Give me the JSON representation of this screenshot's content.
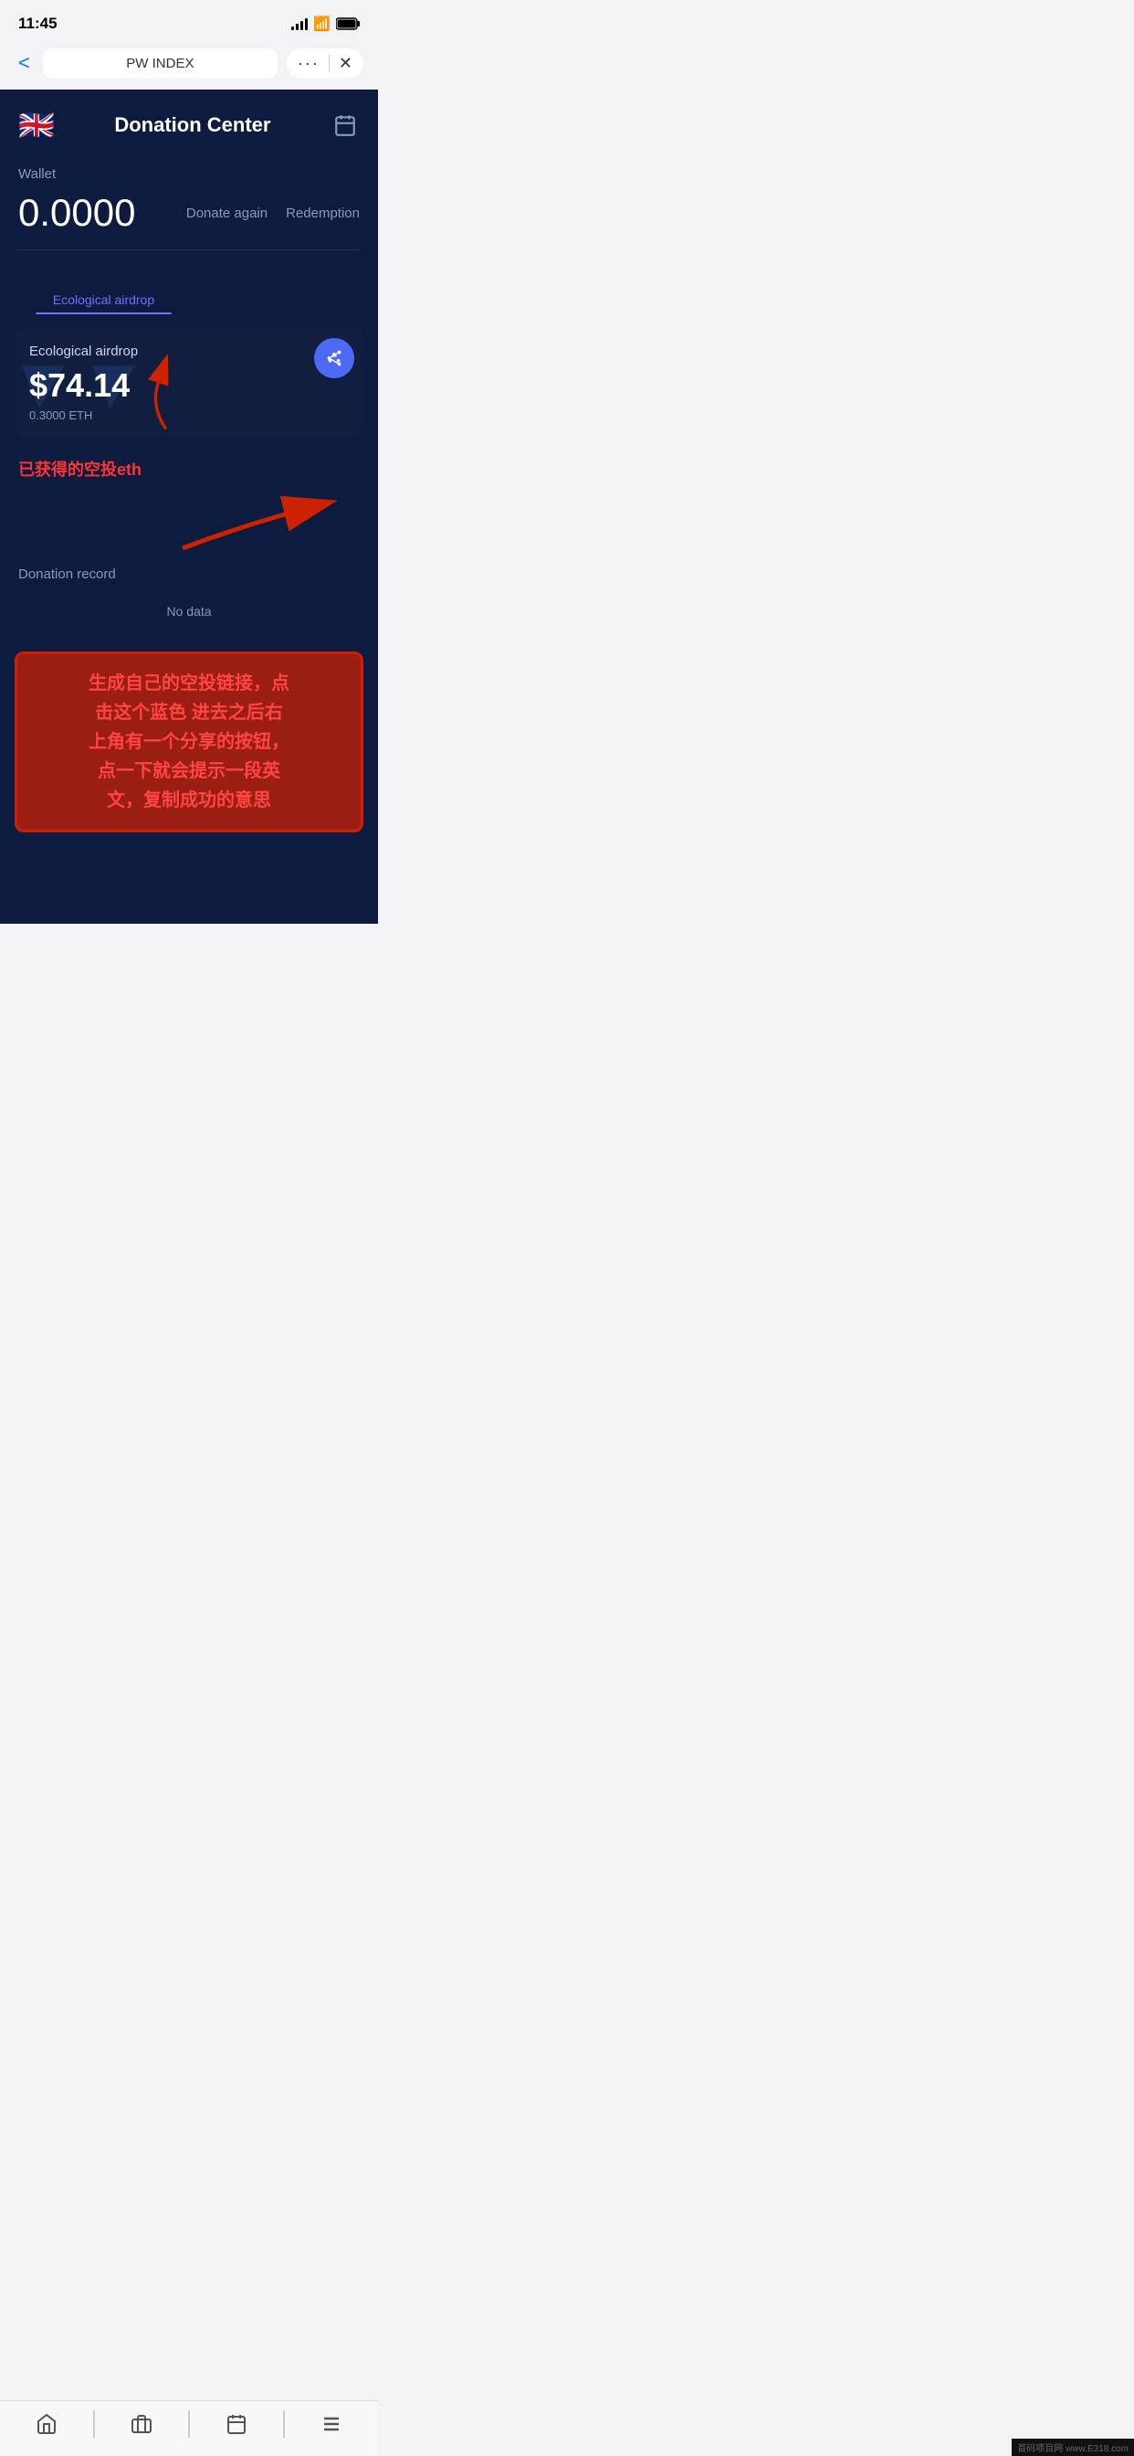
{
  "statusBar": {
    "time": "11:45",
    "signal": "signal-icon",
    "wifi": "wifi-icon",
    "battery": "battery-icon"
  },
  "browserHeader": {
    "backLabel": "<",
    "urlTitle": "PW INDEX",
    "dotsLabel": "···",
    "closeLabel": "✕"
  },
  "appHeader": {
    "title": "Donation Center",
    "flagEmoji": "🇬🇧",
    "calendarIcon": "calendar-icon"
  },
  "wallet": {
    "label": "Wallet",
    "amount": "0.0000",
    "donateAgainLabel": "Donate again",
    "redemptionLabel": "Redemption"
  },
  "tabs": [
    {
      "label": "Ecological airdrop",
      "active": true
    },
    {
      "label": "",
      "active": false
    }
  ],
  "airdropCard": {
    "label": "Ecological airdrop",
    "amount": "$74.14",
    "ethAmount": "0.3000 ETH",
    "shareIconLabel": "share-icon"
  },
  "annotations": {
    "overlayText": "已获得的空投eth",
    "boxText": "生成自己的空投链接，点\n击这个蓝色 进去之后右\n上角有一个分享的按钮，\n点一下就会提示一段英\n文，复制成功的意思"
  },
  "donationRecord": {
    "label": "Donation record",
    "noDataText": "No data"
  },
  "bottomNav": {
    "homeIcon": "home-icon",
    "briefcaseIcon": "briefcase-icon",
    "calendarNavIcon": "calendar-nav-icon",
    "menuIcon": "menu-icon"
  },
  "footer": {
    "text": "首码项目网 www.E318.com"
  }
}
